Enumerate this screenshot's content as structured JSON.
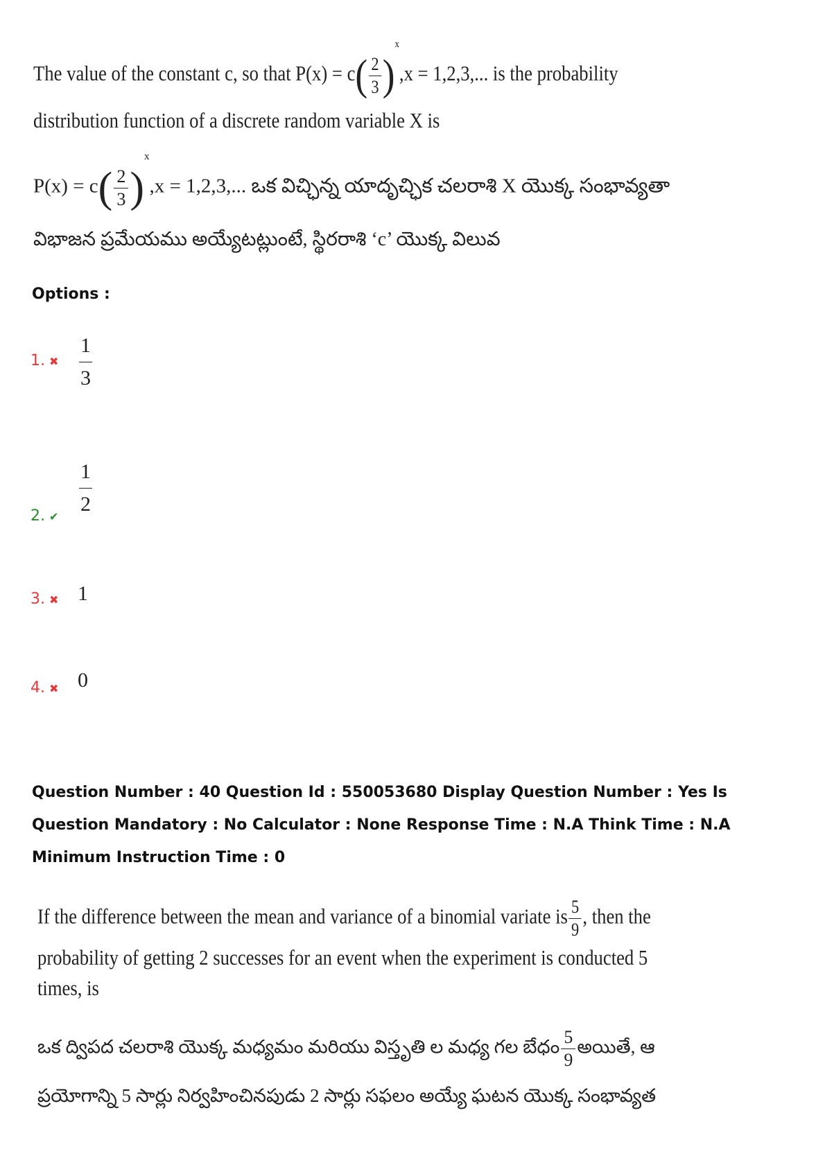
{
  "question1": {
    "english_line1_pre": "The value of the constant c, so that P(x) = c",
    "fraction": {
      "num": "2",
      "den": "3"
    },
    "exponent": "x",
    "english_line1_post": ",x = 1,2,3,... is the probability",
    "english_line2": "distribution function of a discrete random variable X is",
    "telugu_line1_pre": "P(x) = c",
    "telugu_line1_post": ",x = 1,2,3,...  ఒక విచ్ఛిన్న యాదృచ్ఛిక చలరాశి X యొక్క సంభావ్యతా",
    "telugu_line2": "విభాజన ప్రమేయము అయ్యేటట్లుంటే, స్థిరరాశి ‘c’ యొక్క విలువ"
  },
  "options_label": "Options :",
  "options": [
    {
      "number": "1.",
      "mark": "✖",
      "status": "wrong",
      "num": "1",
      "den": "3"
    },
    {
      "number": "2.",
      "mark": "✔",
      "status": "correct",
      "num": "1",
      "den": "2"
    },
    {
      "number": "3.",
      "mark": "✖",
      "status": "wrong",
      "value": "1"
    },
    {
      "number": "4.",
      "mark": "✖",
      "status": "wrong",
      "value": "0"
    }
  ],
  "meta": {
    "text": "Question Number : 40 Question Id : 550053680 Display Question Number : Yes Is Question Mandatory : No Calculator : None Response Time : N.A Think Time : N.A Minimum Instruction Time : 0"
  },
  "question2": {
    "english_line1_pre": "If the difference between the mean and variance of a binomial variate is",
    "fraction": {
      "num": "5",
      "den": "9"
    },
    "english_line1_post": ", then the",
    "english_line2": "probability of getting 2 successes  for an event when the experiment is conducted 5",
    "english_line3": "times, is",
    "telugu_line1_pre": "ఒక ద్విపద చలరాశి యొక్క మధ్యమం మరియు విస్తృతి ల మధ్య గల బేధం",
    "telugu_line1_post": "అయితే,  ఆ",
    "telugu_line2": "ప్రయోగాన్ని 5 సార్లు నిర్వహించినపుడు 2 సార్లు సఫలం అయ్యే ఘటన యొక్క సంభావ్యత"
  }
}
